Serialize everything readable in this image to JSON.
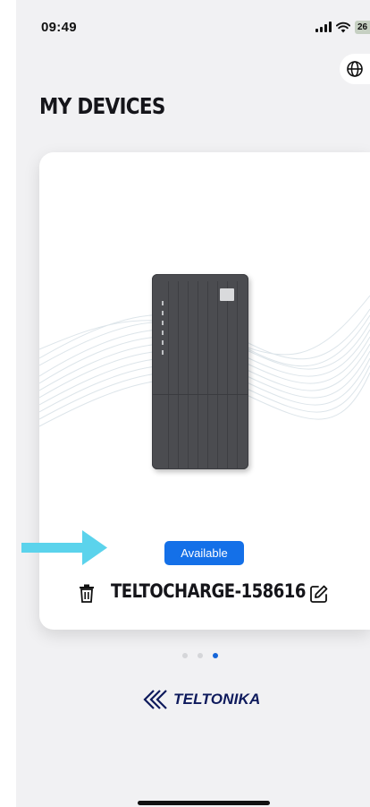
{
  "status_bar": {
    "time": "09:49",
    "battery": "26"
  },
  "header": {
    "title": "MY DEVICES"
  },
  "device": {
    "status": "Available",
    "name": "TELTOCHARGE-158616"
  },
  "pagination": {
    "count": 3,
    "active_index": 2
  },
  "brand": {
    "name": "TELTONIKA"
  },
  "colors": {
    "accent": "#1470e8",
    "arrow": "#5bd3ec",
    "brand": "#0e1a5c"
  },
  "icons": [
    "globe-icon",
    "trash-icon",
    "edit-icon",
    "signal-icon",
    "wifi-icon",
    "battery-icon",
    "teltonika-logo-icon"
  ]
}
